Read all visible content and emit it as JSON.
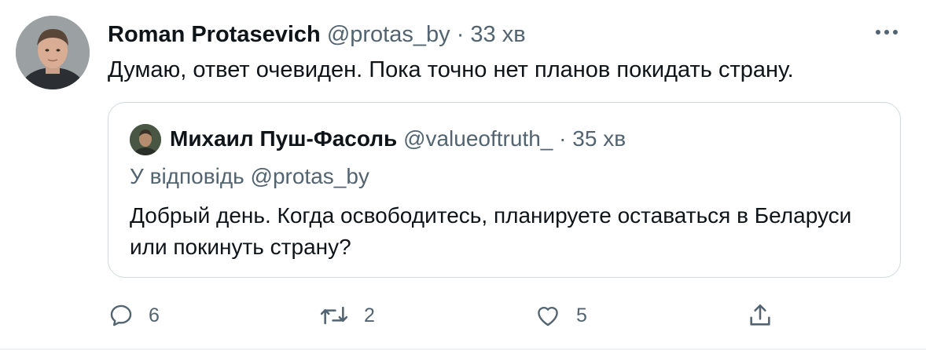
{
  "author": {
    "name": "Roman Protasevich",
    "handle": "@protas_by",
    "separator": "·",
    "time": "33 хв"
  },
  "more_icon": "more-horizontal-icon",
  "tweet": {
    "text": "Думаю, ответ очевиден. Пока точно нет планов покидать страну."
  },
  "quoted": {
    "name": "Михаил Пуш-Фасоль",
    "handle": "@valueoftruth_",
    "separator": "·",
    "time": "35 хв",
    "reply_to": "У відповідь @protas_by",
    "text": "Добрый день. Когда освободитесь, планируете оставаться в Беларуси или покинуть страну?"
  },
  "actions": {
    "reply_count": "6",
    "retweet_count": "2",
    "like_count": "5"
  },
  "colors": {
    "text": "#0f1419",
    "muted": "#536471",
    "border": "#cfd9de"
  }
}
